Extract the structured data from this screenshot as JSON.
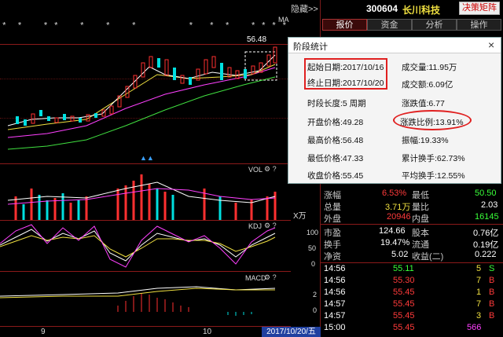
{
  "chart": {
    "ma_label": "MA",
    "price_peak": "56.48",
    "volume_label": "VOL",
    "volume_unit": "X万",
    "kdj_label": "KDJ",
    "macd_label": "MACD",
    "kdj_ticks": [
      "100",
      "50",
      "0"
    ],
    "macd_ticks": [
      "2",
      "0"
    ],
    "x_labels": [
      "9",
      "10"
    ],
    "date_box": "2017/10/20/五",
    "stars": "*  *    * *    *    *    *          *   *  *    * * * *  *   *  *    *",
    "colors": {
      "up": "#ff3030",
      "down": "#00e0e0",
      "ma5": "#ffffff",
      "ma10": "#f0e040",
      "ma20": "#ff40ff",
      "ma60": "#40e040"
    }
  },
  "header": {
    "hidden_label": "隐藏>>",
    "stock_code": "300604",
    "stock_name": "长川科技",
    "decision_button": "决策矩阵"
  },
  "tabs": [
    "报价",
    "资金",
    "分析",
    "操作"
  ],
  "popup": {
    "title": "阶段统计",
    "close": "×",
    "start_date": "起始日期:2017/10/16",
    "end_date": "终止日期:2017/10/20",
    "volume": "成交量:11.95万",
    "amount": "成交额:6.09亿",
    "period": "时段长度:5 周期",
    "change_value": "涨跌值:6.77",
    "open_price": "开盘价格:49.28",
    "change_ratio": "涨跌比例:13.91%",
    "high_price": "最高价格:56.48",
    "amplitude": "振幅:19.33%",
    "low_price": "最低价格:47.33",
    "cumulative_turnover": "累计换手:62.73%",
    "close_price": "收盘价格:55.45",
    "avg_turnover": "平均换手:12.55%"
  },
  "stats": {
    "row1": {
      "l1": "涨幅",
      "v1": "6.53%",
      "l2": "最低",
      "v2": "50.50"
    },
    "row2": {
      "l1": "总量",
      "v1": "3.71万",
      "l2": "量比",
      "v2": "2.03"
    },
    "row3": {
      "l1": "外盘",
      "v1": "20946",
      "l2": "内盘",
      "v2": "16145"
    },
    "row4": {
      "l1": "市盈",
      "v1": "124.66",
      "l2": "股本",
      "v2": "0.76亿"
    },
    "row5": {
      "l1": "换手",
      "v1": "19.47%",
      "l2": "流通",
      "v2": "0.19亿"
    },
    "row6": {
      "l1": "净资",
      "v1": "5.02",
      "l2": "收益(二)",
      "v2": "0.222"
    }
  },
  "trades": [
    {
      "time": "14:56",
      "price": "55.11",
      "vol": "5",
      "dir": "S"
    },
    {
      "time": "14:56",
      "price": "55.30",
      "vol": "7",
      "dir": "B"
    },
    {
      "time": "14:56",
      "price": "55.45",
      "vol": "1",
      "dir": "B"
    },
    {
      "time": "14:57",
      "price": "55.45",
      "vol": "7",
      "dir": "B"
    },
    {
      "time": "14:57",
      "price": "55.45",
      "vol": "3",
      "dir": "B"
    },
    {
      "time": "15:00",
      "price": "55.45",
      "vol": "566",
      "dir": ""
    }
  ]
}
